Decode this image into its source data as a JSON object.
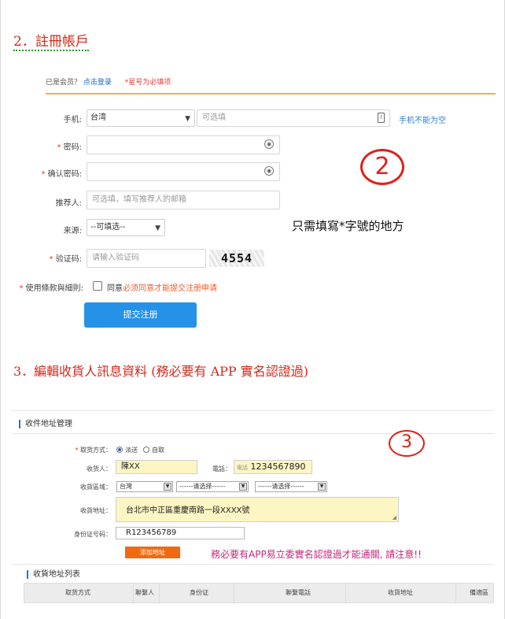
{
  "section2": {
    "heading": "2．註冊帳戶"
  },
  "topbar": {
    "member_prefix": "已是会员？",
    "login_link": "点击登录",
    "required_note": "*星号为必填项"
  },
  "form": {
    "phone_label": "手机:",
    "country_value": "台湾",
    "phone_placeholder": "可选填",
    "phone_note": "手机不能为空",
    "password_label": "密码:",
    "confirm_label": "确认密码:",
    "referrer_label": "推荐人:",
    "referrer_placeholder": "可选填，填写推荐人的邮箱",
    "source_label": "来源:",
    "source_value": "--可填选--",
    "captcha_label": "验证码:",
    "captcha_placeholder": "请输入验证码",
    "captcha_code": "4554",
    "terms_label": "使用條款與細則:",
    "agree_text": "同意",
    "agree_note": "必须同意才能提交注册申请",
    "submit_label": "提交注册"
  },
  "annotation2": {
    "number": "2",
    "text": "只需填寫*字號的地方"
  },
  "section3": {
    "heading": "3．編輯收貨人訊息資料 (務必要有 APP 實名認證過)"
  },
  "address": {
    "section_title": "收件地址管理",
    "method_label": "取货方式：",
    "method_option1": "派送",
    "method_option2": "自取",
    "receiver_label": "收货人：",
    "receiver_value": "陳XX",
    "phone_label": "電話：",
    "phone_prefix": "電話",
    "phone_value": "1234567890",
    "region_label": "收貨區域：",
    "region_country": "台灣",
    "region_select2": "------请选择------",
    "region_select3": "------请选择------",
    "addr_label": "收貨地址：",
    "addr_value": "台北市中正區重慶南路一段XXXX號",
    "id_label": "身份证号码：",
    "id_value": "R123456789",
    "add_button": "添加地址",
    "warning": "務必要有APP易立委實名認證過才能通關, 請注意!!",
    "list_title": "收貨地址列表",
    "columns": [
      "取货方式",
      "聯繫人",
      "身份证",
      "聯繫電話",
      "收貨地址",
      "備適區"
    ]
  },
  "annotation3": {
    "number": "3"
  },
  "colors": {
    "heading_red": "#d12a1c",
    "link_blue": "#1a64c4",
    "submit_blue": "#2592e7",
    "accent_orange": "#f06a12",
    "circle_red": "#e0201b"
  }
}
